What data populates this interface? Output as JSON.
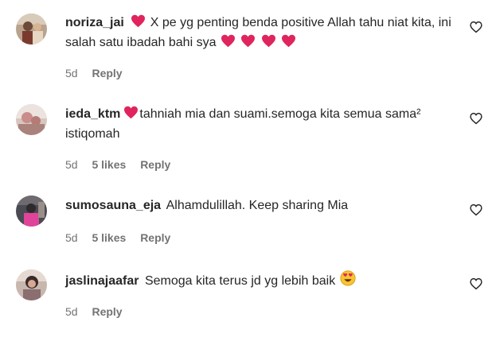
{
  "comments": [
    {
      "username": "noriza_jai",
      "text_after_heart": "X pe yg penting benda positive Allah tahu niat kita, ini salah satu ibadah bahi sya",
      "time": "5d",
      "likes": "",
      "reply": "Reply"
    },
    {
      "username": "ieda_ktm",
      "text": "tahniah mia dan suami.semoga kita semua sama² istiqomah",
      "time": "5d",
      "likes": "5 likes",
      "reply": "Reply"
    },
    {
      "username": "sumosauna_eja",
      "text": "Alhamdulillah. Keep sharing Mia",
      "time": "5d",
      "likes": "5 likes",
      "reply": "Reply"
    },
    {
      "username": "jaslinajaafar",
      "text": "Semoga kita terus jd yg lebih baik",
      "time": "5d",
      "likes": "",
      "reply": "Reply"
    }
  ],
  "colors": {
    "text": "#262626",
    "meta": "#737373",
    "heart_emoji": "#e0245e"
  },
  "icons": {
    "like_button": "heart-outline-icon",
    "emoji_heart": "red-heart-emoji-icon",
    "emoji_heart_eyes": "heart-eyes-emoji-icon"
  }
}
